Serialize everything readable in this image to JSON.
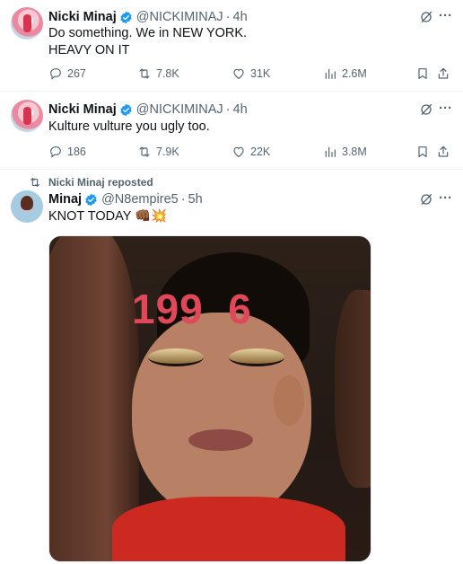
{
  "tweets": [
    {
      "name": "Nicki Minaj",
      "handle": "@NICKIMINAJ",
      "dot": "·",
      "time": "4h",
      "text_lines": [
        "Do something. We in NEW YORK.",
        "HEAVY ON IT"
      ],
      "replies": "267",
      "reposts": "7.8K",
      "likes": "31K",
      "views": "2.6M"
    },
    {
      "name": "Nicki Minaj",
      "handle": "@NICKIMINAJ",
      "dot": "·",
      "time": "4h",
      "text_lines": [
        "Kulture vulture you ugly too."
      ],
      "replies": "186",
      "reposts": "7.9K",
      "likes": "22K",
      "views": "3.8M"
    },
    {
      "reposted_by": "Nicki Minaj reposted",
      "name": "Minaj",
      "handle": "@N8empire5",
      "dot": "·",
      "time": "5h",
      "text_lines": [
        "KNOT TODAY 👊🏾💥"
      ],
      "media_overlay_text": "199  6"
    }
  ],
  "icons": {
    "verified": "verified-badge-icon",
    "grok": "grok-icon",
    "more": "more-icon",
    "reply": "reply-icon",
    "repost": "repost-icon",
    "like": "heart-icon",
    "views": "views-icon",
    "bookmark": "bookmark-icon",
    "share": "share-icon"
  },
  "colors": {
    "verified": "#1d9bf0",
    "secondary_text": "#536471",
    "overlay_text": "#e0485a"
  },
  "more_glyph": "···"
}
